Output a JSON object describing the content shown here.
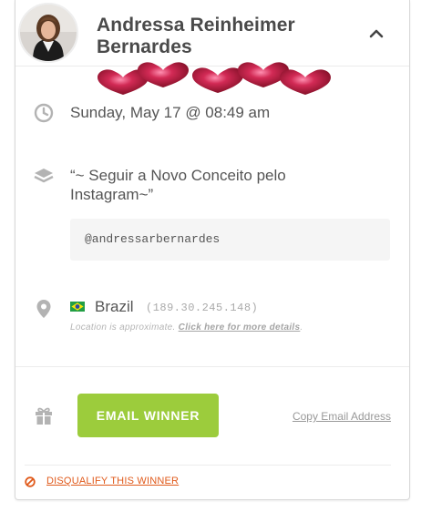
{
  "winner": {
    "name_line1": "Andressa Reinheimer",
    "name_line2": "Bernardes"
  },
  "entry": {
    "date": "Sunday, May 17 @ 08:49 am",
    "action_text": "“~ Seguir a Novo Conceito pelo Instagram~”",
    "value": "@andressarbernardes"
  },
  "location": {
    "country": "Brazil",
    "ip": "(189.30.245.148)",
    "note": "Location is approximate. ",
    "details_link": "Click here for more details",
    "note_end": "."
  },
  "actions": {
    "email_winner": "EMAIL WINNER",
    "copy_email": "Copy Email Address",
    "disqualify": "DISQUALIFY THIS WINNER"
  },
  "icons": {
    "collapse": "chevron-up-icon",
    "date": "clock-icon",
    "entry": "layers-icon",
    "location": "map-pin-icon",
    "prize": "gift-icon",
    "disqualify": "ban-icon",
    "flag": "brazil-flag-icon"
  },
  "colors": {
    "accent_green": "#9ccc3c",
    "danger_orange": "#e05a1b",
    "icon_gray": "#b3b3b3",
    "text_gray": "#555555",
    "heart_red": "#9b1430"
  }
}
